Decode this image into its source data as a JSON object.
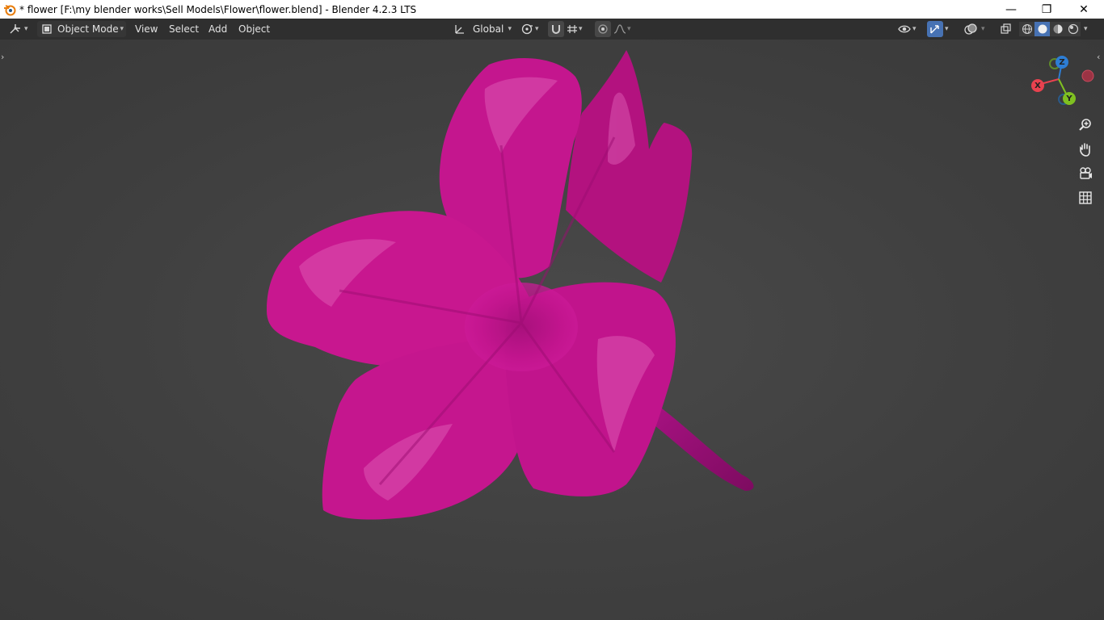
{
  "window": {
    "title": "* flower [F:\\my blender works\\Sell Models\\Flower\\flower.blend] - Blender 4.2.3 LTS",
    "minimize_glyph": "—",
    "maximize_glyph": "❐",
    "close_glyph": "✕"
  },
  "header": {
    "mode": "Object Mode",
    "menus": [
      "View",
      "Select",
      "Add",
      "Object"
    ],
    "transform_orientation": "Global"
  },
  "gizmo": {
    "x_label": "X",
    "y_label": "Y",
    "z_label": "Z",
    "colors": {
      "x": "#e8424f",
      "y": "#7fc021",
      "z": "#2d7dd4"
    }
  },
  "colors": {
    "flower": "#c3158f",
    "header_bg": "#2f2f2f",
    "viewport_bg": "#404040",
    "accent": "#4772b3"
  },
  "icons": {
    "editor_type": "axis-editor-icon",
    "mode": "object-mode-icon",
    "zoom": "zoom-icon",
    "pan": "hand-icon",
    "camera": "camera-icon",
    "ortho": "grid-icon"
  }
}
